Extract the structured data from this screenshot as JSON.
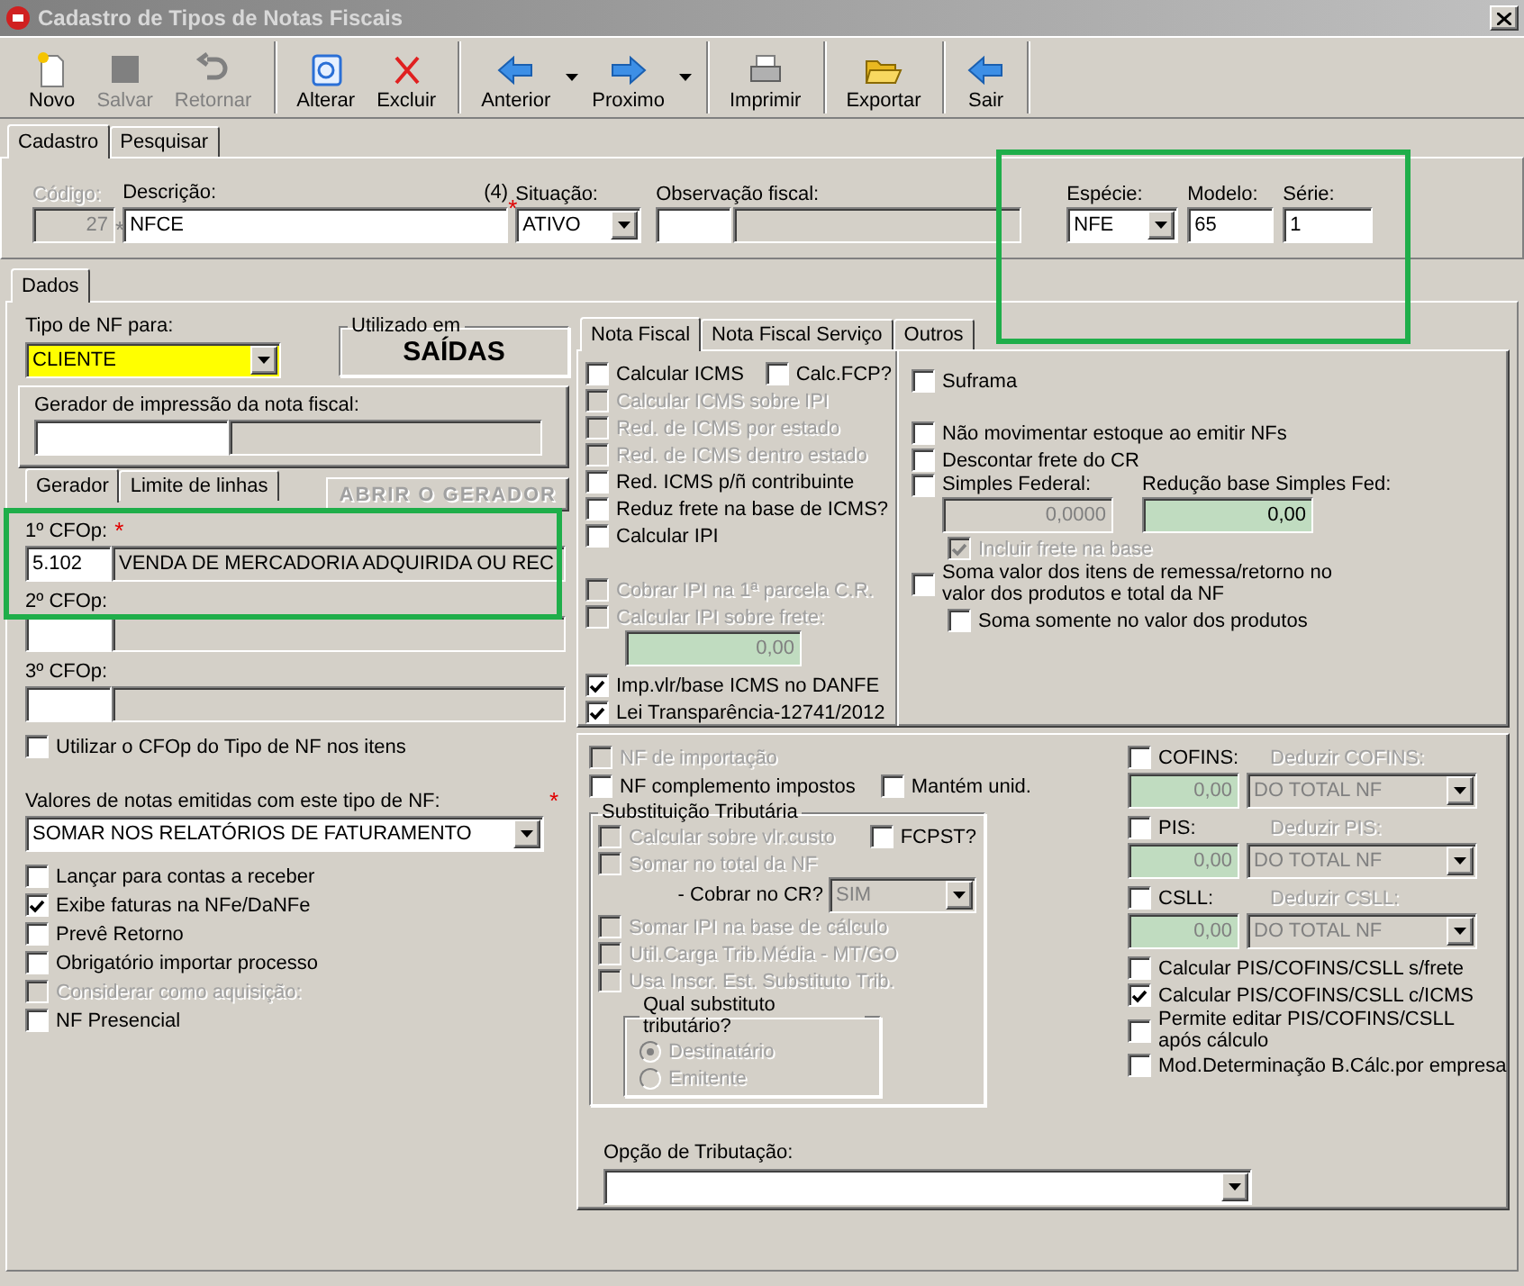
{
  "window": {
    "title": "Cadastro de Tipos de Notas Fiscais"
  },
  "toolbar": [
    {
      "buttons": [
        {
          "kind": "new",
          "label": "Novo",
          "disabled": false
        },
        {
          "kind": "save",
          "label": "Salvar",
          "disabled": true
        },
        {
          "kind": "undo",
          "label": "Retornar",
          "disabled": true
        }
      ]
    },
    {
      "buttons": [
        {
          "kind": "edit",
          "label": "Alterar",
          "disabled": false
        },
        {
          "kind": "delete",
          "label": "Excluir",
          "disabled": false
        }
      ]
    },
    {
      "buttons": [
        {
          "kind": "back",
          "label": "Anterior",
          "disabled": false,
          "dropdown": true
        },
        {
          "kind": "forward",
          "label": "Proximo",
          "disabled": false,
          "dropdown": true
        }
      ]
    },
    {
      "buttons": [
        {
          "kind": "print",
          "label": "Imprimir",
          "disabled": false
        }
      ]
    },
    {
      "buttons": [
        {
          "kind": "export",
          "label": "Exportar",
          "disabled": false
        }
      ]
    },
    {
      "buttons": [
        {
          "kind": "exit",
          "label": "Sair",
          "disabled": false
        }
      ]
    }
  ],
  "form_tabs": [
    {
      "label": "Cadastro",
      "selected": true
    },
    {
      "label": "Pesquisar",
      "selected": false
    }
  ],
  "header": {
    "codigo": {
      "label": "Código:",
      "value": "27",
      "mark": "*"
    },
    "descricao": {
      "label": "Descrição:",
      "counter": "(4)",
      "value": "NFCE",
      "mark": "*"
    },
    "situacao": {
      "label": "Situação:",
      "value": "ATIVO"
    },
    "observacao": {
      "label": "Observação fiscal:"
    },
    "especie": {
      "label": "Espécie:",
      "value": "NFE"
    },
    "modelo": {
      "label": "Modelo:",
      "value": "65"
    },
    "serie": {
      "label": "Série:",
      "value": "1"
    }
  },
  "data_tabs": [
    {
      "label": "Dados",
      "selected": true
    }
  ],
  "left": {
    "tipo_nf": {
      "label": "Tipo de NF para:",
      "value": "CLIENTE"
    },
    "utilizado": {
      "title": "Utilizado em",
      "value": "SAÍDAS"
    },
    "gerador": {
      "label": "Gerador de impressão da nota fiscal:"
    },
    "gerador_tabs": [
      {
        "label": "Gerador",
        "selected": true
      },
      {
        "label": "Limite de linhas",
        "selected": false
      }
    ],
    "open_button": {
      "label": "ABRIR O GERADOR",
      "disabled": true
    },
    "cfops": [
      {
        "label": "1º CFOp:",
        "code": "5.102",
        "description": "VENDA DE MERCADORIA ADQUIRIDA OU REC",
        "mark": "*"
      },
      {
        "label": "2º CFOp:"
      },
      {
        "label": "3º CFOp:"
      }
    ],
    "use_cfop": {
      "label": "Utilizar o CFOp do Tipo de NF nos itens",
      "checked": false,
      "disabled": false
    },
    "valores": {
      "label": "Valores de notas emitidas com este tipo de NF:",
      "value": "SOMAR NOS RELATÓRIOS DE FATURAMENTO",
      "mark": "*"
    },
    "options": [
      {
        "label": "Lançar para contas a receber",
        "checked": false,
        "disabled": false
      },
      {
        "label": "Exibe faturas na NFe/DaNFe",
        "checked": true,
        "disabled": false
      },
      {
        "label": "Prevê Retorno",
        "checked": false,
        "disabled": false
      },
      {
        "label": "Obrigatório importar processo",
        "checked": false,
        "disabled": false
      },
      {
        "label": "Considerar como aquisição:",
        "checked": false,
        "disabled": true
      },
      {
        "label": "NF Presencial",
        "checked": false,
        "disabled": false
      }
    ]
  },
  "right_tabs": [
    {
      "label": "Nota Fiscal",
      "selected": true
    },
    {
      "label": "Nota Fiscal Serviço",
      "selected": false
    },
    {
      "label": "Outros",
      "selected": false
    }
  ],
  "nota_fiscal": {
    "icms": [
      {
        "label": "Calcular ICMS",
        "checked": false,
        "disabled": false,
        "extra": {
          "label": "Calc.FCP?",
          "checked": false,
          "disabled": false
        }
      },
      {
        "label": "Calcular ICMS sobre IPI",
        "checked": false,
        "disabled": true
      },
      {
        "label": "Red. de ICMS por estado",
        "checked": false,
        "disabled": true
      },
      {
        "label": "Red. de ICMS dentro estado",
        "checked": false,
        "disabled": true
      },
      {
        "label": "Red. ICMS p/ñ contribuinte",
        "checked": false,
        "disabled": false
      },
      {
        "label": "Reduz frete na base de ICMS?",
        "checked": false,
        "disabled": false
      },
      {
        "label": "Calcular IPI",
        "checked": false,
        "disabled": false
      }
    ],
    "ipi": [
      {
        "label": "Cobrar IPI na 1ª parcela C.R.",
        "checked": false,
        "disabled": true
      },
      {
        "label": "Calcular IPI sobre frete:",
        "checked": false,
        "disabled": true
      }
    ],
    "ipi_frete_value": "0,00",
    "danfe": [
      {
        "label": "Imp.vlr/base ICMS no DANFE",
        "checked": true,
        "disabled": false
      },
      {
        "label": "Lei Transparência-12741/2012",
        "checked": true,
        "disabled": false
      }
    ],
    "suframa": {
      "label": "Suframa",
      "checked": false,
      "disabled": false
    },
    "estoque": [
      {
        "label": "Não movimentar estoque ao emitir NFs",
        "checked": false,
        "disabled": false
      },
      {
        "label": "Descontar frete do CR",
        "checked": false,
        "disabled": false
      }
    ],
    "simples": {
      "label": "Simples Federal:",
      "checked": false,
      "disabled": false,
      "value": "0,0000",
      "reducao_label": "Redução base Simples Fed:",
      "reducao_value": "0,00"
    },
    "incluir_frete": {
      "label": "Incluir frete na base",
      "checked": true,
      "disabled": true
    },
    "soma": {
      "label": "Soma valor dos itens de remessa/retorno no valor dos produtos e total da NF",
      "checked": false,
      "disabled": false
    },
    "soma_somente": {
      "label": "Soma somente no valor dos produtos",
      "checked": false,
      "disabled": false
    }
  },
  "impostos": {
    "top": [
      {
        "label": "NF de importação",
        "checked": false,
        "disabled": true
      },
      {
        "label": "NF complemento impostos",
        "checked": false,
        "disabled": false,
        "extra": {
          "label": "Mantém unid.",
          "checked": false,
          "disabled": false
        }
      }
    ],
    "st": {
      "title": "Substituição Tributária",
      "calc_custo": {
        "label": "Calcular sobre vlr.custo",
        "checked": false,
        "disabled": true,
        "extra": {
          "label": "FCPST?",
          "checked": false,
          "disabled": false
        }
      },
      "somar_total": {
        "label": "Somar no total da NF",
        "checked": false,
        "disabled": true
      },
      "cobrar": {
        "label": "- Cobrar no CR?",
        "value": "SIM",
        "disabled": true
      },
      "more": [
        {
          "label": "Somar IPI na base de cálculo",
          "checked": false,
          "disabled": true
        },
        {
          "label": "Util.Carga Trib.Média - MT/GO",
          "checked": false,
          "disabled": true
        },
        {
          "label": "Usa Inscr. Est. Substituto Trib.",
          "checked": false,
          "disabled": true
        }
      ],
      "substituto": {
        "title": "Qual substituto tributário?",
        "options": [
          {
            "label": "Destinatário",
            "selected": true,
            "disabled": true
          },
          {
            "label": "Emitente",
            "selected": false,
            "disabled": true
          }
        ]
      }
    },
    "taxes": [
      {
        "label": "COFINS:",
        "checked": false,
        "value": "0,00",
        "deduct_label": "Deduzir COFINS:",
        "deduct": "DO TOTAL NF"
      },
      {
        "label": "PIS:",
        "checked": false,
        "value": "0,00",
        "deduct_label": "Deduzir PIS:",
        "deduct": "DO TOTAL NF"
      },
      {
        "label": "CSLL:",
        "checked": false,
        "value": "0,00",
        "deduct_label": "Deduzir CSLL:",
        "deduct": "DO TOTAL NF"
      }
    ],
    "pis_options": [
      {
        "label": "Calcular PIS/COFINS/CSLL s/frete",
        "checked": false,
        "disabled": false
      },
      {
        "label": "Calcular PIS/COFINS/CSLL c/ICMS",
        "checked": true,
        "disabled": false
      },
      {
        "label": "Permite editar PIS/COFINS/CSLL após cálculo",
        "checked": false,
        "disabled": false
      },
      {
        "label": "Mod.Determinação B.Cálc.por empresa",
        "checked": false,
        "disabled": false
      }
    ],
    "opcao": {
      "label": "Opção de Tributação:"
    }
  },
  "highlights": [
    {
      "kind": "frame"
    },
    {
      "kind": "frame"
    }
  ]
}
